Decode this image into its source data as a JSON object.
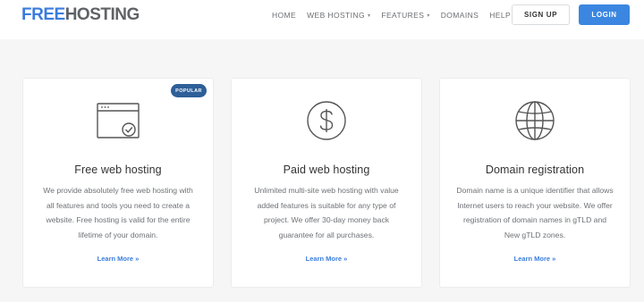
{
  "brand": {
    "part1": "FREE",
    "part2": "HOSTING",
    "color_primary": "#3b7ddd",
    "color_secondary": "#5f6266"
  },
  "nav": {
    "items": [
      {
        "label": "HOME"
      },
      {
        "label": "WEB HOSTING",
        "caret": "▾"
      },
      {
        "label": "FEATURES",
        "caret": "▾"
      },
      {
        "label": "DOMAINS"
      },
      {
        "label": "HELP",
        "caret": "▾"
      }
    ]
  },
  "header_buttons": {
    "signup": "SIGN UP",
    "login": "LOGIN",
    "login_color": "#3b86e0"
  },
  "cards": [
    {
      "icon": "browser-window-check-icon",
      "badge": "POPULAR",
      "title": "Free web hosting",
      "desc": "We provide absolutely free web hosting with all features and tools you need to create a website. Free hosting is valid for the entire lifetime of your domain.",
      "more": "Learn More »"
    },
    {
      "icon": "dollar-coin-icon",
      "title": "Paid web hosting",
      "desc": "Unlimited multi-site web hosting with value added features is suitable for any type of project. We offer 30-day money back guarantee for all purchases.",
      "more": "Learn More »"
    },
    {
      "icon": "globe-icon",
      "title": "Domain registration",
      "desc": "Domain name is a unique identifier that allows Internet users to reach your website. We offer registration of domain names in gTLD and New gTLD zones.",
      "more": "Learn More »"
    }
  ]
}
